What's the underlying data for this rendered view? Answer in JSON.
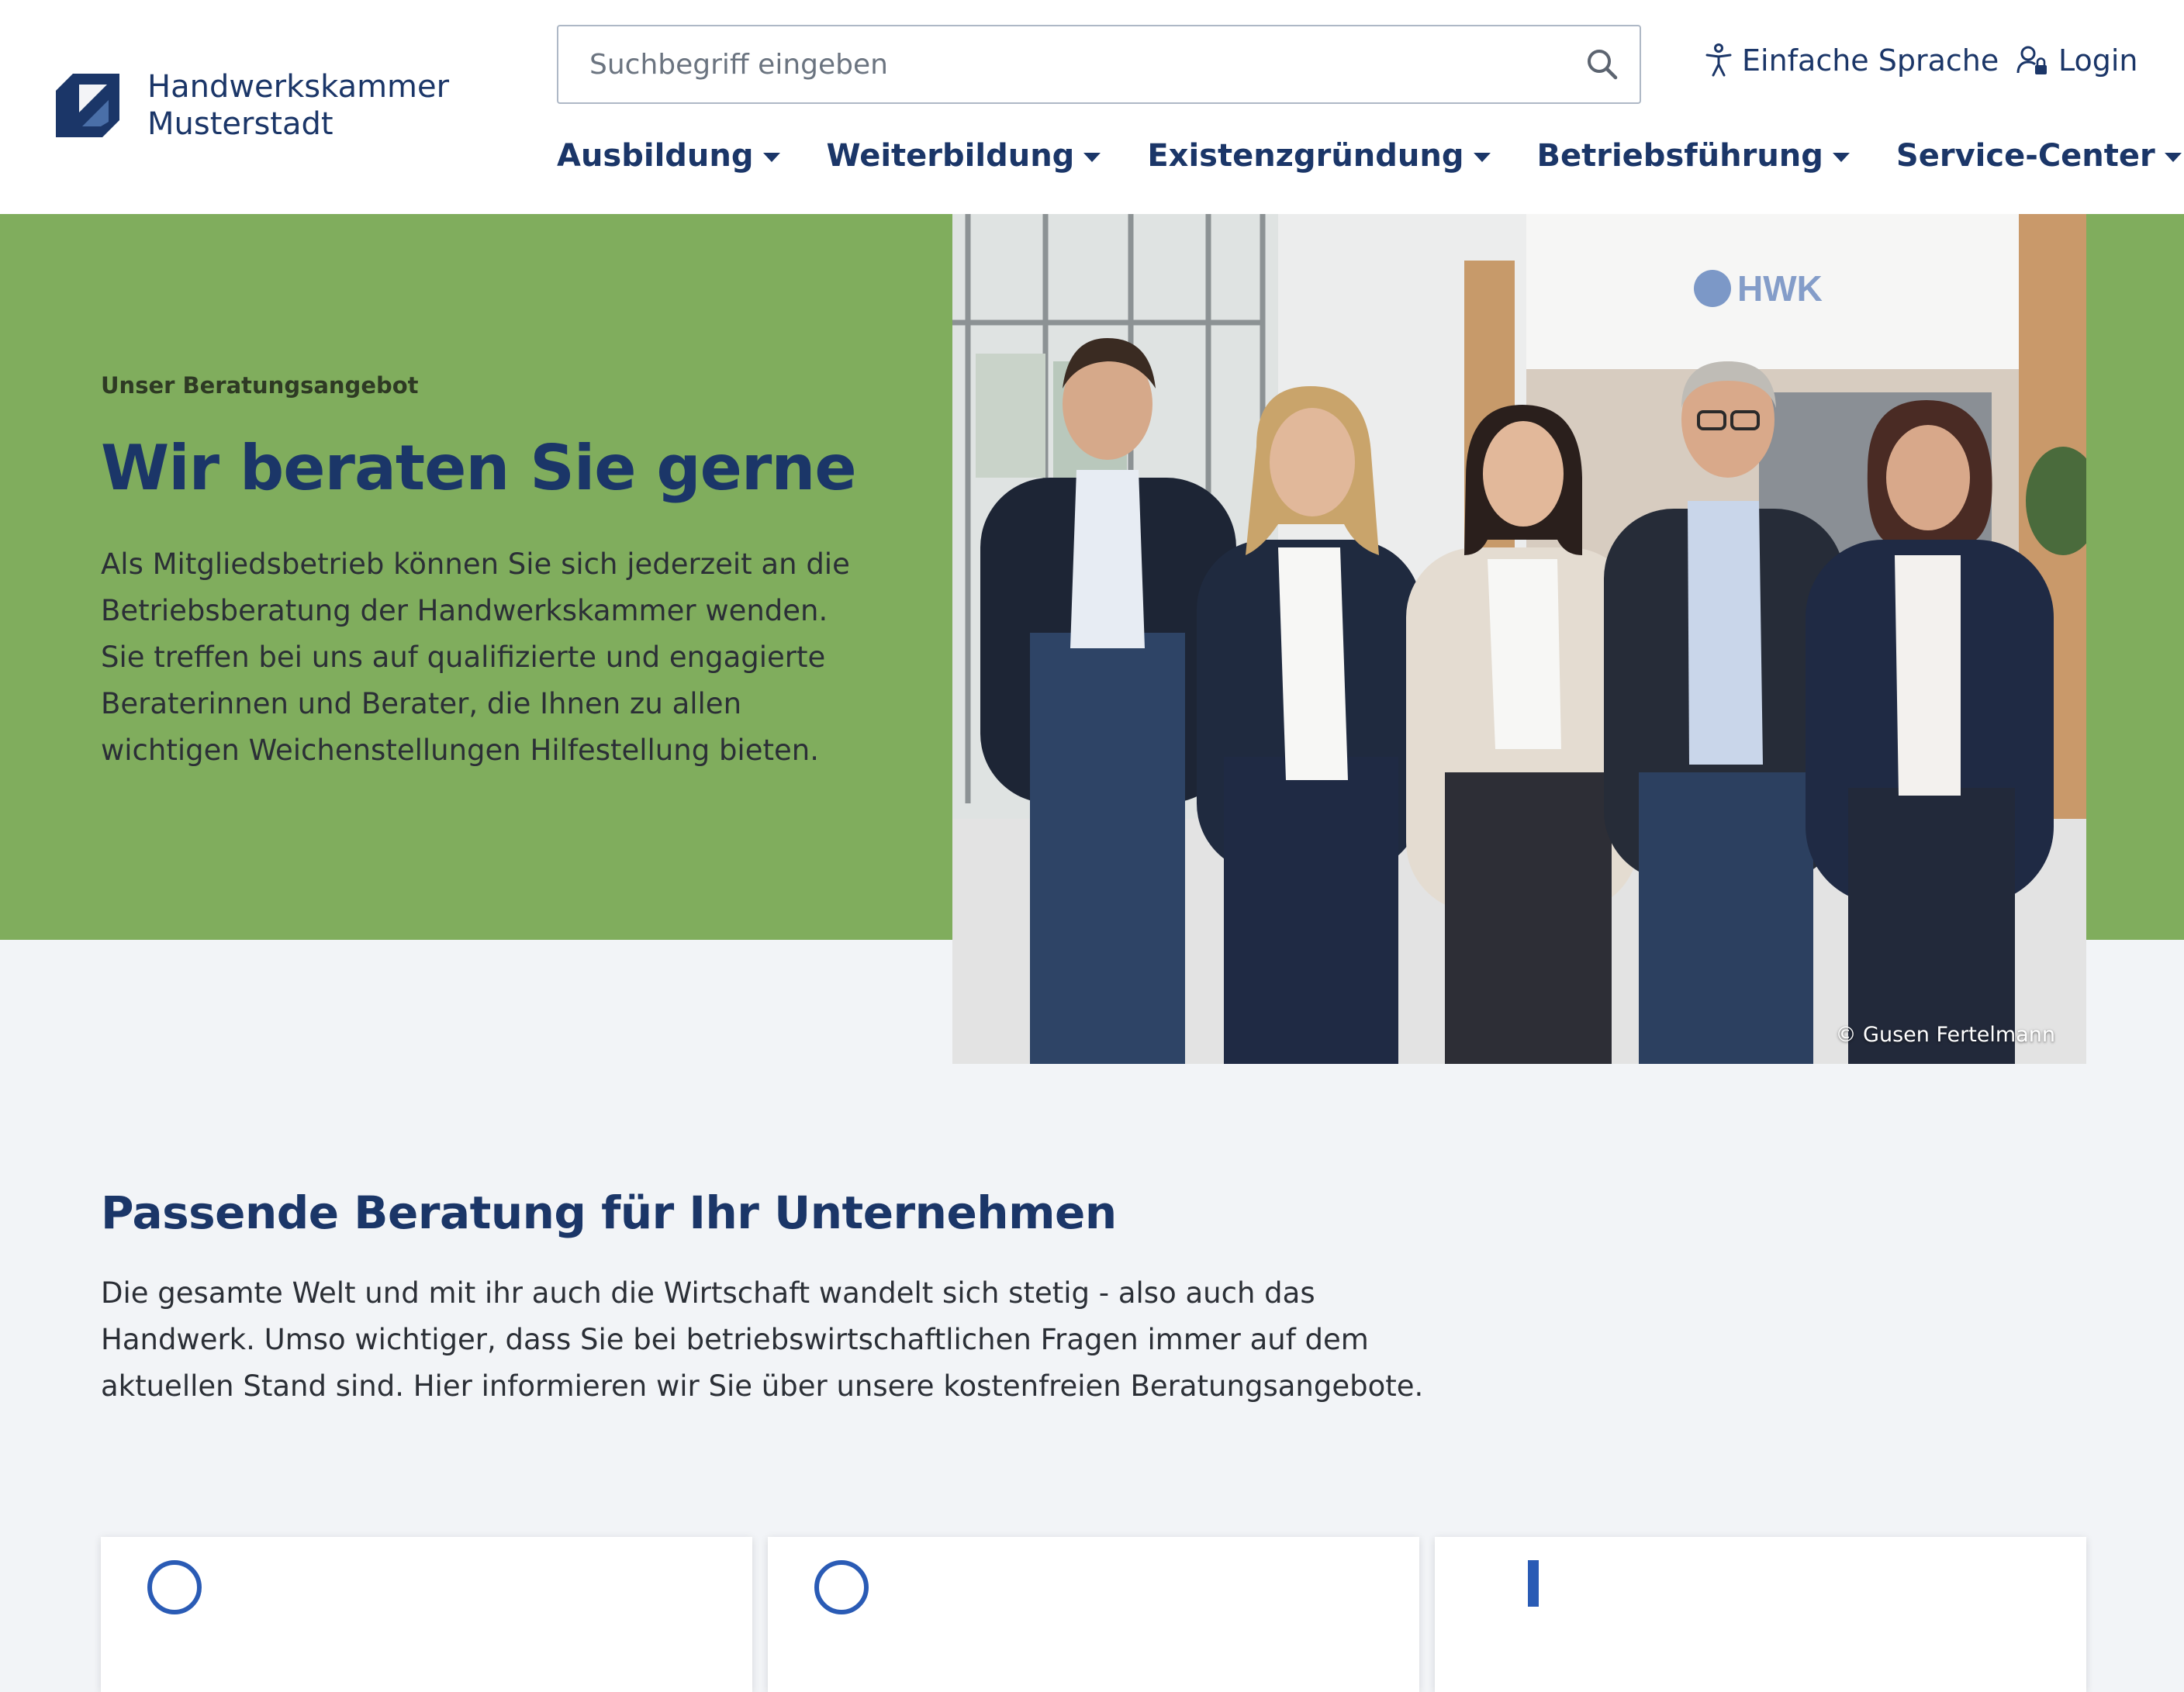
{
  "header": {
    "logo_line1": "Handwerkskammer",
    "logo_line2": "Musterstadt",
    "search_placeholder": "Suchbegriff eingeben",
    "simple_language": "Einfache Sprache",
    "login": "Login"
  },
  "nav": {
    "items": [
      {
        "label": "Ausbildung"
      },
      {
        "label": "Weiterbildung"
      },
      {
        "label": "Existenzgründung"
      },
      {
        "label": "Betriebsführung"
      },
      {
        "label": "Service-Center"
      }
    ]
  },
  "hero": {
    "eyebrow": "Unser Beratungsangebot",
    "title": "Wir beraten Sie gerne",
    "body": "Als Mitgliedsbetrieb können Sie sich jederzeit an die Betriebsberatung der Handwerkskammer wenden. Sie treffen bei uns auf qualifizierte und engagierte Beraterinnen und Berater, die Ihnen zu allen wichtigen Weichenstellungen Hilfestellung bieten.",
    "photo_credit": "© Gusen Fertelmann",
    "photo_sign": "HWK"
  },
  "section": {
    "title": "Passende Beratung für Ihr Unternehmen",
    "body": "Die gesamte Welt und mit ihr auch die Wirtschaft wandelt sich stetig - also auch das Handwerk. Umso wichtiger, dass Sie bei betriebswirtschaftlichen Fragen immer auf dem aktuellen Stand sind. Hier informieren wir Sie über unsere kostenfreien Beratungsangebote."
  },
  "colors": {
    "brand_blue": "#1b3668",
    "hero_green": "#80ad5d",
    "page_bg": "#f2f4f7",
    "accent_blue": "#2a5bb5"
  },
  "icons": [
    "logo-mark-icon",
    "search-icon",
    "accessibility-icon",
    "user-lock-icon",
    "caret-down-icon"
  ]
}
